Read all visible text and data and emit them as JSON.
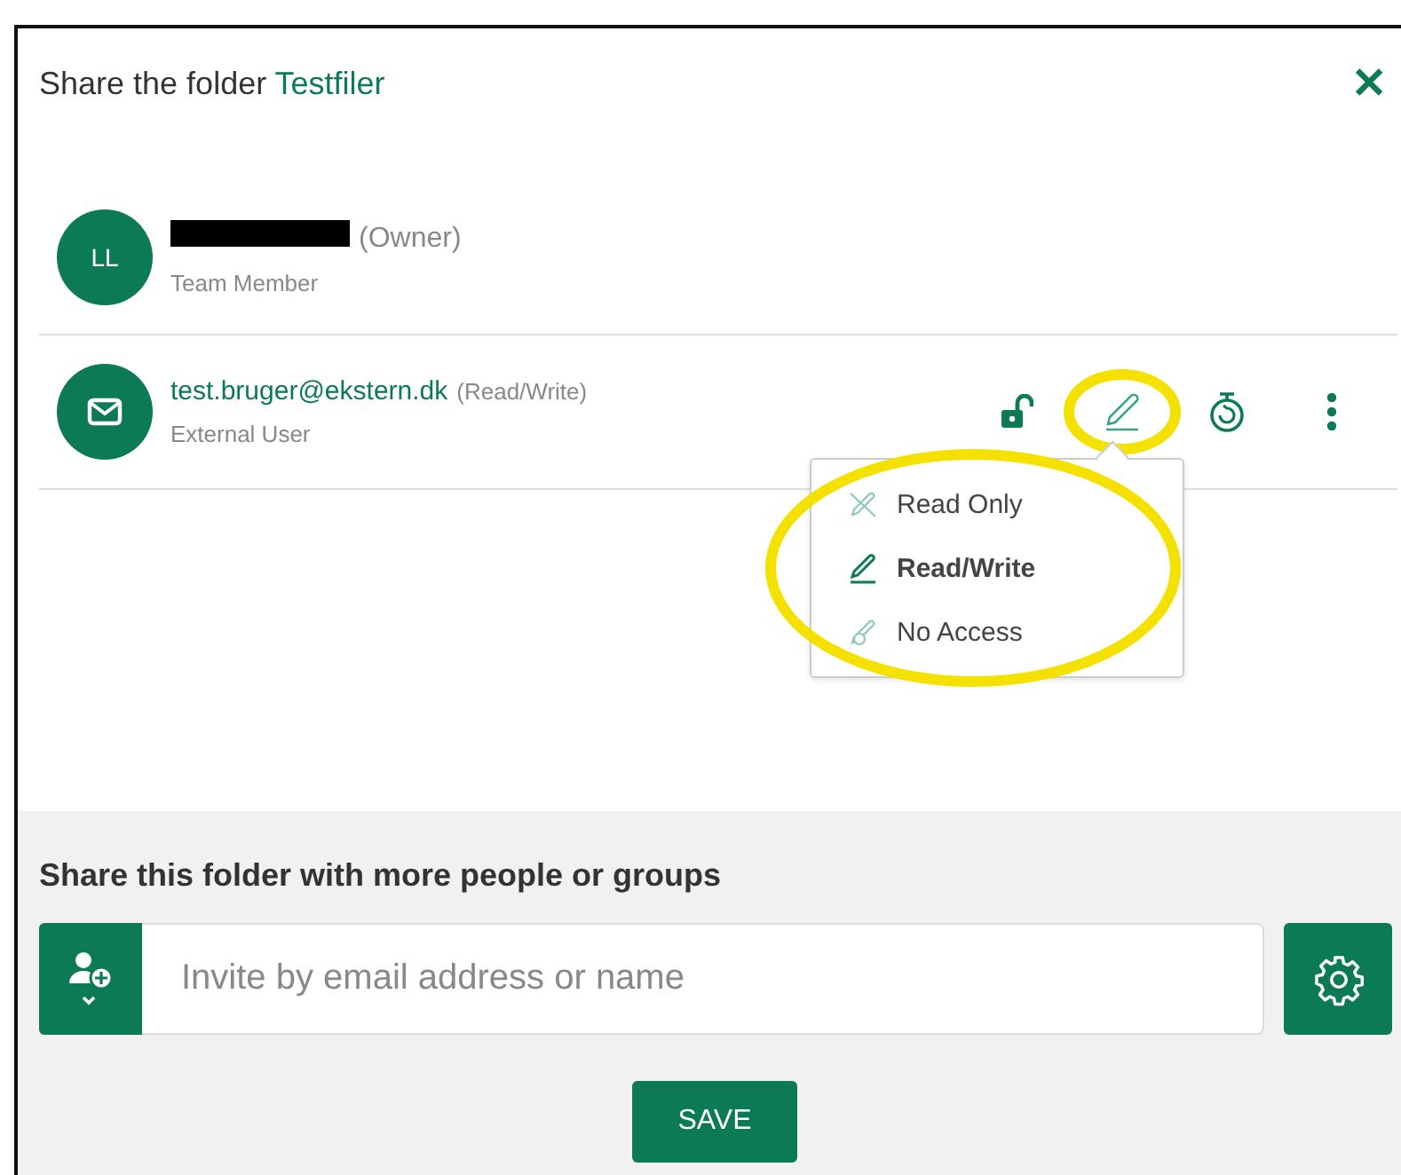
{
  "dialog": {
    "title": "Share the folder",
    "folder": "Testfiler",
    "close": "✕"
  },
  "members": [
    {
      "kind": "team",
      "initials": "LL",
      "redacted": true,
      "role_tag": "(Owner)",
      "subtitle": "Team Member"
    },
    {
      "kind": "external",
      "name": "test.bruger@ekstern.dk",
      "role_tag": "(Read/Write)",
      "subtitle": "External User",
      "actions": [
        {
          "kind": "unlock",
          "highlighted": false
        },
        {
          "kind": "pencil",
          "highlighted": true
        },
        {
          "kind": "timer",
          "highlighted": false
        },
        {
          "kind": "more",
          "highlighted": false
        }
      ]
    }
  ],
  "permission_menu": {
    "highlighted": true,
    "items": [
      {
        "kind": "read",
        "label": "Read Only",
        "selected": false
      },
      {
        "kind": "write",
        "label": "Read/Write",
        "selected": true
      },
      {
        "kind": "none",
        "label": "No Access",
        "selected": false
      }
    ]
  },
  "invite": {
    "heading": "Share this folder with more people or groups",
    "placeholder": "Invite by email address or name",
    "save": "SAVE"
  }
}
